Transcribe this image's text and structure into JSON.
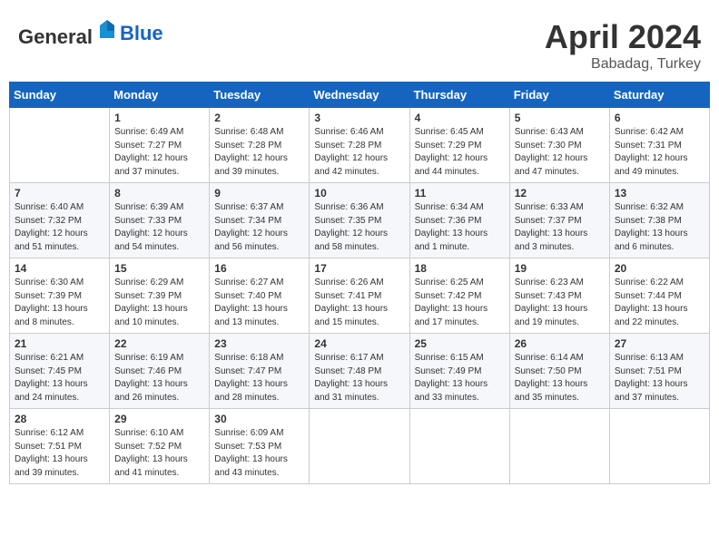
{
  "header": {
    "logo_general": "General",
    "logo_blue": "Blue",
    "month_year": "April 2024",
    "location": "Babadag, Turkey"
  },
  "weekdays": [
    "Sunday",
    "Monday",
    "Tuesday",
    "Wednesday",
    "Thursday",
    "Friday",
    "Saturday"
  ],
  "weeks": [
    [
      {
        "day": "",
        "sunrise": "",
        "sunset": "",
        "daylight": ""
      },
      {
        "day": "1",
        "sunrise": "Sunrise: 6:49 AM",
        "sunset": "Sunset: 7:27 PM",
        "daylight": "Daylight: 12 hours and 37 minutes."
      },
      {
        "day": "2",
        "sunrise": "Sunrise: 6:48 AM",
        "sunset": "Sunset: 7:28 PM",
        "daylight": "Daylight: 12 hours and 39 minutes."
      },
      {
        "day": "3",
        "sunrise": "Sunrise: 6:46 AM",
        "sunset": "Sunset: 7:28 PM",
        "daylight": "Daylight: 12 hours and 42 minutes."
      },
      {
        "day": "4",
        "sunrise": "Sunrise: 6:45 AM",
        "sunset": "Sunset: 7:29 PM",
        "daylight": "Daylight: 12 hours and 44 minutes."
      },
      {
        "day": "5",
        "sunrise": "Sunrise: 6:43 AM",
        "sunset": "Sunset: 7:30 PM",
        "daylight": "Daylight: 12 hours and 47 minutes."
      },
      {
        "day": "6",
        "sunrise": "Sunrise: 6:42 AM",
        "sunset": "Sunset: 7:31 PM",
        "daylight": "Daylight: 12 hours and 49 minutes."
      }
    ],
    [
      {
        "day": "7",
        "sunrise": "Sunrise: 6:40 AM",
        "sunset": "Sunset: 7:32 PM",
        "daylight": "Daylight: 12 hours and 51 minutes."
      },
      {
        "day": "8",
        "sunrise": "Sunrise: 6:39 AM",
        "sunset": "Sunset: 7:33 PM",
        "daylight": "Daylight: 12 hours and 54 minutes."
      },
      {
        "day": "9",
        "sunrise": "Sunrise: 6:37 AM",
        "sunset": "Sunset: 7:34 PM",
        "daylight": "Daylight: 12 hours and 56 minutes."
      },
      {
        "day": "10",
        "sunrise": "Sunrise: 6:36 AM",
        "sunset": "Sunset: 7:35 PM",
        "daylight": "Daylight: 12 hours and 58 minutes."
      },
      {
        "day": "11",
        "sunrise": "Sunrise: 6:34 AM",
        "sunset": "Sunset: 7:36 PM",
        "daylight": "Daylight: 13 hours and 1 minute."
      },
      {
        "day": "12",
        "sunrise": "Sunrise: 6:33 AM",
        "sunset": "Sunset: 7:37 PM",
        "daylight": "Daylight: 13 hours and 3 minutes."
      },
      {
        "day": "13",
        "sunrise": "Sunrise: 6:32 AM",
        "sunset": "Sunset: 7:38 PM",
        "daylight": "Daylight: 13 hours and 6 minutes."
      }
    ],
    [
      {
        "day": "14",
        "sunrise": "Sunrise: 6:30 AM",
        "sunset": "Sunset: 7:39 PM",
        "daylight": "Daylight: 13 hours and 8 minutes."
      },
      {
        "day": "15",
        "sunrise": "Sunrise: 6:29 AM",
        "sunset": "Sunset: 7:39 PM",
        "daylight": "Daylight: 13 hours and 10 minutes."
      },
      {
        "day": "16",
        "sunrise": "Sunrise: 6:27 AM",
        "sunset": "Sunset: 7:40 PM",
        "daylight": "Daylight: 13 hours and 13 minutes."
      },
      {
        "day": "17",
        "sunrise": "Sunrise: 6:26 AM",
        "sunset": "Sunset: 7:41 PM",
        "daylight": "Daylight: 13 hours and 15 minutes."
      },
      {
        "day": "18",
        "sunrise": "Sunrise: 6:25 AM",
        "sunset": "Sunset: 7:42 PM",
        "daylight": "Daylight: 13 hours and 17 minutes."
      },
      {
        "day": "19",
        "sunrise": "Sunrise: 6:23 AM",
        "sunset": "Sunset: 7:43 PM",
        "daylight": "Daylight: 13 hours and 19 minutes."
      },
      {
        "day": "20",
        "sunrise": "Sunrise: 6:22 AM",
        "sunset": "Sunset: 7:44 PM",
        "daylight": "Daylight: 13 hours and 22 minutes."
      }
    ],
    [
      {
        "day": "21",
        "sunrise": "Sunrise: 6:21 AM",
        "sunset": "Sunset: 7:45 PM",
        "daylight": "Daylight: 13 hours and 24 minutes."
      },
      {
        "day": "22",
        "sunrise": "Sunrise: 6:19 AM",
        "sunset": "Sunset: 7:46 PM",
        "daylight": "Daylight: 13 hours and 26 minutes."
      },
      {
        "day": "23",
        "sunrise": "Sunrise: 6:18 AM",
        "sunset": "Sunset: 7:47 PM",
        "daylight": "Daylight: 13 hours and 28 minutes."
      },
      {
        "day": "24",
        "sunrise": "Sunrise: 6:17 AM",
        "sunset": "Sunset: 7:48 PM",
        "daylight": "Daylight: 13 hours and 31 minutes."
      },
      {
        "day": "25",
        "sunrise": "Sunrise: 6:15 AM",
        "sunset": "Sunset: 7:49 PM",
        "daylight": "Daylight: 13 hours and 33 minutes."
      },
      {
        "day": "26",
        "sunrise": "Sunrise: 6:14 AM",
        "sunset": "Sunset: 7:50 PM",
        "daylight": "Daylight: 13 hours and 35 minutes."
      },
      {
        "day": "27",
        "sunrise": "Sunrise: 6:13 AM",
        "sunset": "Sunset: 7:51 PM",
        "daylight": "Daylight: 13 hours and 37 minutes."
      }
    ],
    [
      {
        "day": "28",
        "sunrise": "Sunrise: 6:12 AM",
        "sunset": "Sunset: 7:51 PM",
        "daylight": "Daylight: 13 hours and 39 minutes."
      },
      {
        "day": "29",
        "sunrise": "Sunrise: 6:10 AM",
        "sunset": "Sunset: 7:52 PM",
        "daylight": "Daylight: 13 hours and 41 minutes."
      },
      {
        "day": "30",
        "sunrise": "Sunrise: 6:09 AM",
        "sunset": "Sunset: 7:53 PM",
        "daylight": "Daylight: 13 hours and 43 minutes."
      },
      {
        "day": "",
        "sunrise": "",
        "sunset": "",
        "daylight": ""
      },
      {
        "day": "",
        "sunrise": "",
        "sunset": "",
        "daylight": ""
      },
      {
        "day": "",
        "sunrise": "",
        "sunset": "",
        "daylight": ""
      },
      {
        "day": "",
        "sunrise": "",
        "sunset": "",
        "daylight": ""
      }
    ]
  ]
}
